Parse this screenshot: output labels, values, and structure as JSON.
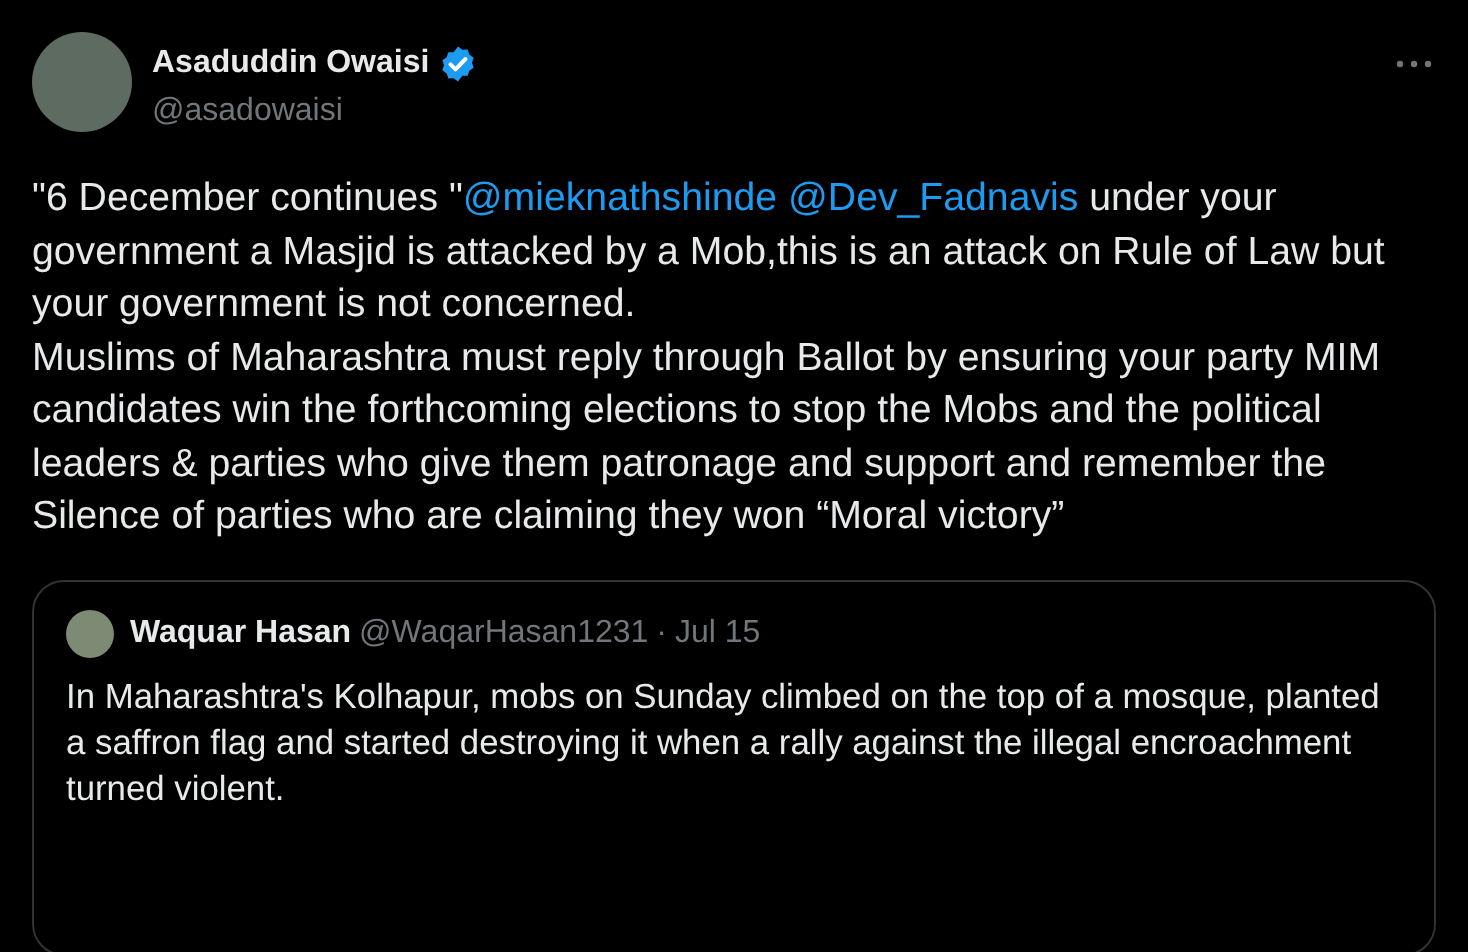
{
  "author": {
    "name": "Asaduddin Owaisi",
    "handle": "@asadowaisi",
    "verified": true
  },
  "paragraphs": [
    [
      {
        "kind": "text",
        "text": "\"6 December continues \""
      },
      {
        "kind": "mention",
        "text": "@mieknathshinde"
      },
      {
        "kind": "mention",
        "text": "@Dev_Fadnavis"
      },
      {
        "kind": "text",
        "text": " under your government a Masjid is attacked by a Mob,this is an attack on Rule of Law but your government is not concerned."
      }
    ],
    [
      {
        "kind": "text",
        "text": "Muslims of Maharashtra must reply through Ballot by ensuring your party MIM candidates win the forthcoming elections to stop the Mobs and the political leaders & parties who give them patronage and support and remember the Silence of parties who are claiming they won “Moral victory”"
      }
    ]
  ],
  "quote": {
    "name": "Waquar Hasan",
    "handle": "@WaqarHasan1231",
    "separator": "·",
    "date": "Jul 15",
    "text": "In Maharashtra's Kolhapur, mobs on Sunday climbed on the top of a mosque, planted a saffron flag and started destroying it when a rally against the illegal encroachment turned violent."
  }
}
